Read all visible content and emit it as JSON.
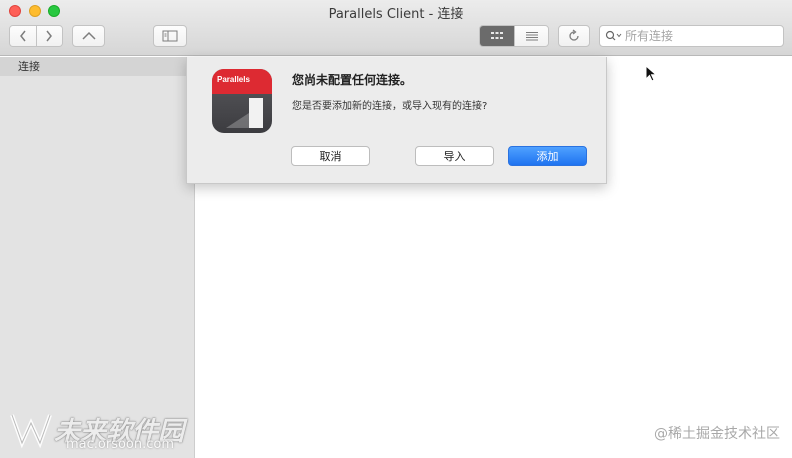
{
  "window": {
    "title": "Parallels Client - 连接"
  },
  "toolbar": {
    "back_icon": "chevron-left-icon",
    "forward_icon": "chevron-right-icon",
    "up_icon": "chevron-up-icon",
    "sidebar_toggle_icon": "sidebar-icon",
    "grid_view_icon": "grid-icon",
    "list_view_icon": "list-icon",
    "refresh_icon": "refresh-icon",
    "search": {
      "placeholder": "所有连接",
      "value": ""
    }
  },
  "sidebar": {
    "items": [
      {
        "label": "连接",
        "selected": true
      }
    ]
  },
  "dialog": {
    "icon_text": "Parallels",
    "title": "您尚未配置任何连接。",
    "message": "您是否要添加新的连接，或导入现有的连接?",
    "buttons": {
      "cancel": "取消",
      "import": "导入",
      "add": "添加"
    }
  },
  "watermarks": {
    "left_main": "未来软件园",
    "left_url": "mac.orsoon.com",
    "right": "@稀土掘金技术社区"
  }
}
